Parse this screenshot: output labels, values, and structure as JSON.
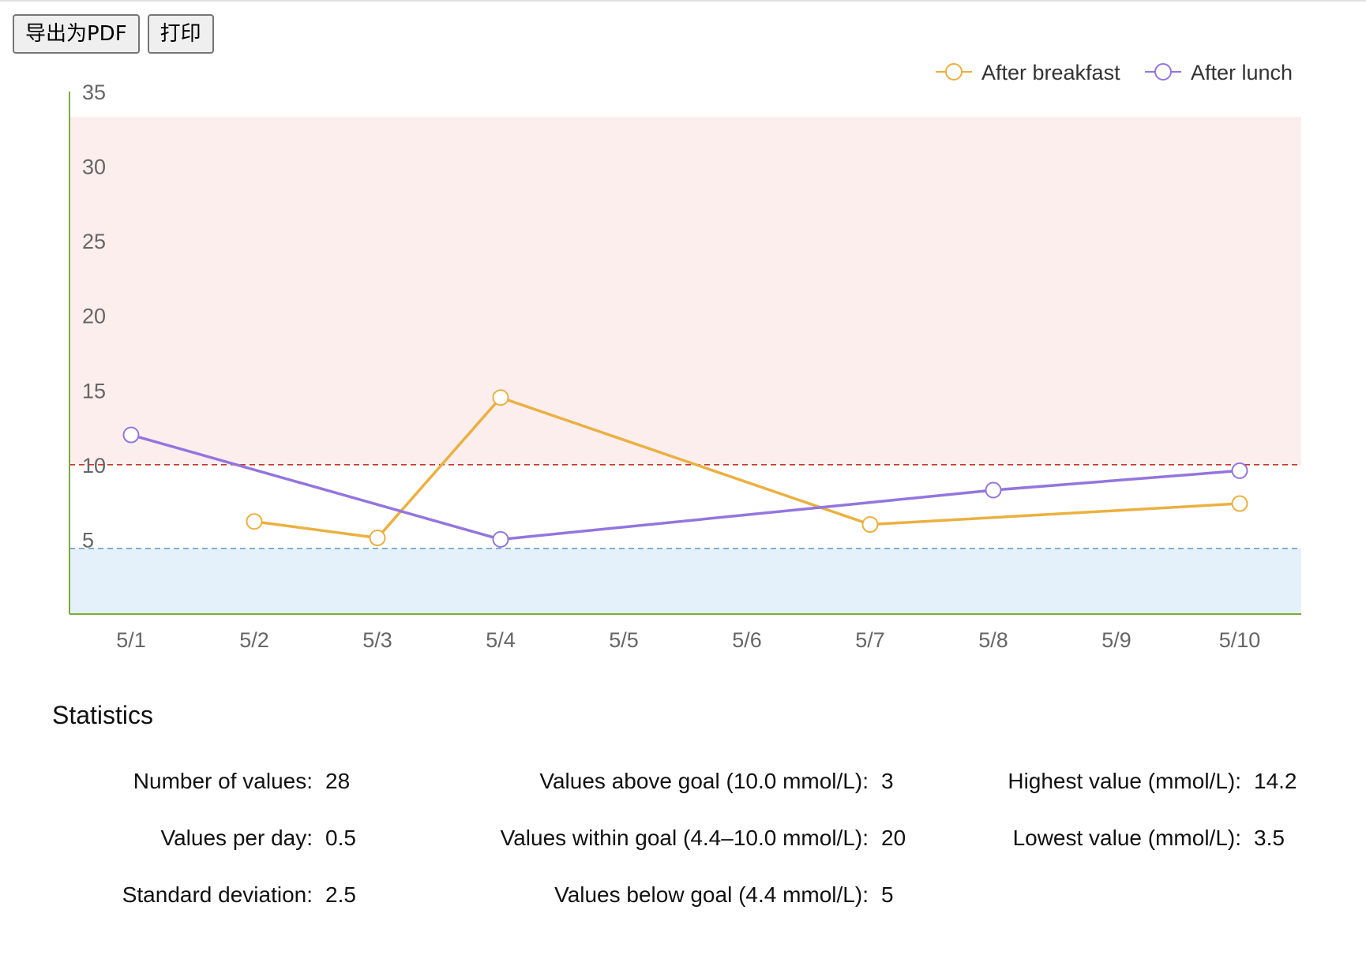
{
  "toolbar": {
    "export_label": "导出为PDF",
    "print_label": "打印"
  },
  "colors": {
    "breakfast": "#ebb040",
    "lunch": "#9475de",
    "high_band": "#fdeeee",
    "low_band": "#e4f1fb",
    "high_line": "#c0392b",
    "low_line": "#6f9fc8",
    "axis": "#7cab3a"
  },
  "chart_data": {
    "type": "line",
    "categories": [
      "5/1",
      "5/2",
      "5/3",
      "5/4",
      "5/5",
      "5/6",
      "5/7",
      "5/8",
      "5/9",
      "5/10"
    ],
    "ylim": [
      0,
      35
    ],
    "yticks": [
      5,
      10,
      15,
      20,
      25,
      30,
      35
    ],
    "series": [
      {
        "name": "After breakfast",
        "values": [
          null,
          6.2,
          5.1,
          14.5,
          null,
          null,
          6.0,
          null,
          null,
          7.4
        ]
      },
      {
        "name": "After lunch",
        "values": [
          12.0,
          null,
          null,
          5.0,
          null,
          null,
          null,
          8.3,
          null,
          9.6
        ]
      }
    ],
    "goal_high": 10,
    "goal_low": 4.4,
    "legend_position": "top-right",
    "grid": false
  },
  "statistics": {
    "title": "Statistics",
    "items": [
      {
        "label": "Number of values:",
        "value": "28"
      },
      {
        "label": "Values per day:",
        "value": "0.5"
      },
      {
        "label": "Standard deviation:",
        "value": "2.5"
      },
      {
        "label": "Values above goal (10.0 mmol/L):",
        "value": "3"
      },
      {
        "label": "Values within goal (4.4–10.0 mmol/L):",
        "value": "20"
      },
      {
        "label": "Values below goal (4.4 mmol/L):",
        "value": "5"
      },
      {
        "label": "Highest value (mmol/L):",
        "value": "14.2"
      },
      {
        "label": "Lowest value (mmol/L):",
        "value": "3.5"
      }
    ]
  }
}
